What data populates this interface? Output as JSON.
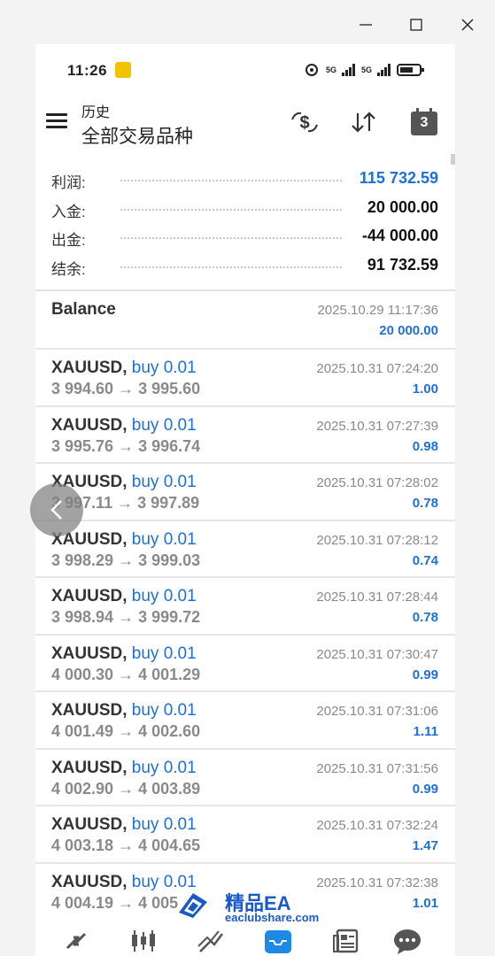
{
  "window": {
    "minimize_glyph": "—",
    "maximize_glyph": "☐",
    "close_glyph": "✕"
  },
  "status_bar": {
    "time": "11:26",
    "network_1": "5G",
    "network_2": "5G",
    "icons": [
      "app-notification-icon",
      "hotspot-icon",
      "signal-icon",
      "signal-icon",
      "battery-icon"
    ]
  },
  "header": {
    "subtitle": "历史",
    "title": "全部交易品种",
    "calendar_day": "3",
    "icons": [
      "menu-icon",
      "currency-exchange-icon",
      "sort-icon",
      "calendar-icon"
    ]
  },
  "summary": [
    {
      "label": "利润:",
      "value": "115 732.59",
      "accent": true
    },
    {
      "label": "入金:",
      "value": "20 000.00",
      "accent": false
    },
    {
      "label": "出金:",
      "value": "-44 000.00",
      "accent": false
    },
    {
      "label": "结余:",
      "value": "91 732.59",
      "accent": false
    }
  ],
  "balance_entry": {
    "title": "Balance",
    "time": "2025.10.29 11:17:36",
    "amount": "20 000.00"
  },
  "trades": [
    {
      "symbol": "XAUUSD,",
      "type": "buy 0.01",
      "prices": "3 994.60 → 3 995.60",
      "time": "2025.10.31 07:24:20",
      "profit": "1.00"
    },
    {
      "symbol": "XAUUSD,",
      "type": "buy 0.01",
      "prices": "3 995.76 → 3 996.74",
      "time": "2025.10.31 07:27:39",
      "profit": "0.98"
    },
    {
      "symbol": "XAUUSD,",
      "type": "buy 0.01",
      "prices": "3 997.11 → 3 997.89",
      "time": "2025.10.31 07:28:02",
      "profit": "0.78"
    },
    {
      "symbol": "XAUUSD,",
      "type": "buy 0.01",
      "prices": "3 998.29 → 3 999.03",
      "time": "2025.10.31 07:28:12",
      "profit": "0.74"
    },
    {
      "symbol": "XAUUSD,",
      "type": "buy 0.01",
      "prices": "3 998.94 → 3 999.72",
      "time": "2025.10.31 07:28:44",
      "profit": "0.78"
    },
    {
      "symbol": "XAUUSD,",
      "type": "buy 0.01",
      "prices": "4 000.30 → 4 001.29",
      "time": "2025.10.31 07:30:47",
      "profit": "0.99"
    },
    {
      "symbol": "XAUUSD,",
      "type": "buy 0.01",
      "prices": "4 001.49 → 4 002.60",
      "time": "2025.10.31 07:31:06",
      "profit": "1.11"
    },
    {
      "symbol": "XAUUSD,",
      "type": "buy 0.01",
      "prices": "4 002.90 → 4 003.89",
      "time": "2025.10.31 07:31:56",
      "profit": "0.99"
    },
    {
      "symbol": "XAUUSD,",
      "type": "buy 0.01",
      "prices": "4 003.18 → 4 004.65",
      "time": "2025.10.31 07:32:24",
      "profit": "1.47"
    },
    {
      "symbol": "XAUUSD,",
      "type": "buy 0.01",
      "prices": "4 004.19 → 4 005",
      "time": "2025.10.31 07:32:38",
      "profit": "1.01"
    }
  ],
  "bottom_nav": [
    "quotes-icon",
    "chart-icon",
    "trade-icon",
    "history-icon",
    "news-icon",
    "messages-icon"
  ],
  "watermark": {
    "name": "精品EA",
    "domain": "eaclubshare.com"
  },
  "colors": {
    "accent": "#1e6fd9",
    "text": "#333333",
    "muted": "#8a8a8a",
    "active_nav": "#1e88e5"
  }
}
